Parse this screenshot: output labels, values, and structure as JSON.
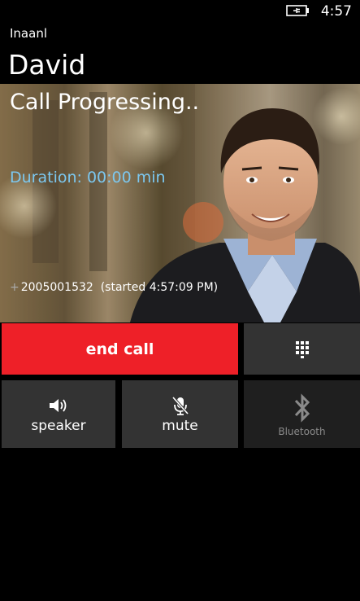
{
  "status_bar": {
    "time": "4:57",
    "battery_icon": "battery-charging-icon"
  },
  "app": {
    "name": "Inaanl"
  },
  "caller": {
    "name": "David"
  },
  "call": {
    "status": "Call Progressing..",
    "duration": "Duration: 00:00 min",
    "number_prefix": "+",
    "number": "2005001532",
    "started": "(started 4:57:09 PM)"
  },
  "buttons": {
    "end_call": "end call",
    "keypad_icon": "keypad-icon",
    "speaker": "speaker",
    "mute": "mute",
    "bluetooth": "Bluetooth"
  },
  "colors": {
    "end_call": "#ee2028",
    "duration": "#7cc8f0",
    "button": "#333333"
  }
}
